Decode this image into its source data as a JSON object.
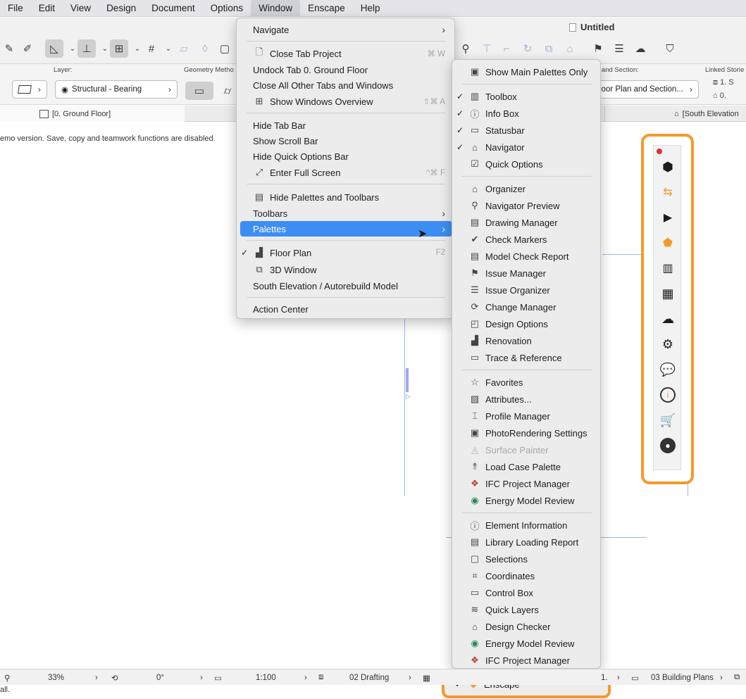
{
  "menubar": {
    "items": [
      "File",
      "Edit",
      "View",
      "Design",
      "Document",
      "Options",
      "Window",
      "Enscape",
      "Help"
    ]
  },
  "window_title": "Untitled",
  "infobox": {
    "layer_label": "Layer:",
    "layer_value": "Structural - Bearing",
    "geometry_label": "Geometry Metho",
    "section_label": "n and Section:",
    "section_value": "loor Plan and Section...",
    "linked_label": "Linked Storie",
    "linked_1": "1. S",
    "linked_2": "0. "
  },
  "tabs": {
    "left": "[0. Ground Floor]",
    "right": "[South Elevation"
  },
  "demo_message": "emo version. Save, copy and teamwork functions are disabled.",
  "window_menu": {
    "items": [
      {
        "label": "Navigate",
        "submenu": true
      },
      {
        "label": "Close Tab Project",
        "shortcut": "⌘ W",
        "icon": "close-tab-icon"
      },
      {
        "label": "Undock Tab 0. Ground Floor"
      },
      {
        "label": "Close All Other Tabs and Windows"
      },
      {
        "label": "Show Windows Overview",
        "shortcut": "⇧⌘ A",
        "icon": "grid-icon"
      },
      {
        "label": "Hide Tab Bar"
      },
      {
        "label": "Show Scroll Bar"
      },
      {
        "label": "Hide Quick Options Bar"
      },
      {
        "label": "Enter Full Screen",
        "shortcut": "^⌘ F",
        "icon": "fullscreen-icon"
      },
      {
        "label": "Hide Palettes and Toolbars",
        "icon": "palettes-icon"
      },
      {
        "label": "Toolbars",
        "submenu": true
      },
      {
        "label": "Palettes",
        "submenu": true
      },
      {
        "label": "Floor Plan",
        "shortcut": "F2",
        "checked": true,
        "icon": "floor-plan-icon"
      },
      {
        "label": "3D Window",
        "icon": "3d-window-icon"
      },
      {
        "label": "South Elevation / Autorebuild Model"
      },
      {
        "label": "Action Center"
      }
    ]
  },
  "palettes_menu": {
    "items": [
      {
        "label": "Show Main Palettes Only",
        "icon": "main-palettes-icon"
      },
      {
        "label": "Toolbox",
        "checked": true,
        "icon": "toolbox-icon"
      },
      {
        "label": "Info Box",
        "checked": true,
        "icon": "info-box-icon"
      },
      {
        "label": "Statusbar",
        "checked": true,
        "icon": "statusbar-icon"
      },
      {
        "label": "Navigator",
        "checked": true,
        "icon": "navigator-icon"
      },
      {
        "label": "Quick Options",
        "icon": "quick-options-icon"
      },
      {
        "label": "Organizer",
        "icon": "organizer-icon"
      },
      {
        "label": "Navigator Preview",
        "icon": "navigator-preview-icon"
      },
      {
        "label": "Drawing Manager",
        "icon": "drawing-manager-icon"
      },
      {
        "label": "Check Markers",
        "icon": "check-markers-icon"
      },
      {
        "label": "Model Check Report",
        "icon": "model-check-report-icon"
      },
      {
        "label": "Issue Manager",
        "icon": "issue-manager-icon"
      },
      {
        "label": "Issue Organizer",
        "icon": "issue-organizer-icon"
      },
      {
        "label": "Change Manager",
        "icon": "change-manager-icon"
      },
      {
        "label": "Design Options",
        "icon": "design-options-icon"
      },
      {
        "label": "Renovation",
        "icon": "renovation-icon"
      },
      {
        "label": "Trace & Reference",
        "icon": "trace-reference-icon"
      },
      {
        "label": "Favorites",
        "icon": "star-icon"
      },
      {
        "label": "Attributes...",
        "icon": "attributes-icon"
      },
      {
        "label": "Profile Manager",
        "icon": "profile-manager-icon"
      },
      {
        "label": "PhotoRendering Settings",
        "icon": "photorendering-icon"
      },
      {
        "label": "Surface Painter",
        "disabled": true,
        "icon": "surface-painter-icon"
      },
      {
        "label": "Load Case Palette",
        "icon": "load-case-icon"
      },
      {
        "label": "IFC Project Manager",
        "icon": "ifc-icon"
      },
      {
        "label": "Energy Model Review",
        "icon": "energy-icon"
      },
      {
        "label": "Element Information",
        "icon": "element-information-icon"
      },
      {
        "label": "Library Loading Report",
        "icon": "library-report-icon"
      },
      {
        "label": "Selections",
        "icon": "selections-icon"
      },
      {
        "label": "Coordinates",
        "icon": "coordinates-icon"
      },
      {
        "label": "Control Box",
        "icon": "control-box-icon"
      },
      {
        "label": "Quick Layers",
        "icon": "quick-layers-icon"
      },
      {
        "label": "Design Checker",
        "icon": "design-checker-icon"
      },
      {
        "label": "Energy Model Review",
        "icon": "energy-icon"
      },
      {
        "label": "IFC Project Manager",
        "icon": "ifc-icon"
      },
      {
        "label": "Enscape",
        "checked": true,
        "icon": "enscape-icon"
      }
    ]
  },
  "statusbar": {
    "zoom": "33%",
    "angle": "0°",
    "scale": "1:100",
    "layer_combo": "02 Drafting",
    "partial": "1.",
    "view_set": "03 Building Plans"
  },
  "bottom_text": "all.",
  "colors": {
    "accent_blue": "#3d8ef3",
    "enscape_orange": "#f39a2b"
  }
}
